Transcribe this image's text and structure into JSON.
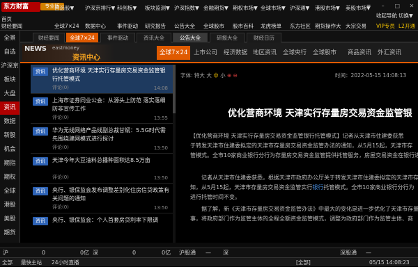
{
  "app": {
    "logo": "东方财富",
    "edition": "专业版"
  },
  "top_menu": {
    "row1": [
      "首页",
      "自选股▼",
      "沪深京排行▼",
      "科创板▼",
      "板块监测▼",
      "沪深指数▼",
      "金融期货▼",
      "期权市场▼",
      "全球市场▼",
      "沪深通▼",
      "港股市场▼",
      "美股市场▼",
      "收起导航",
      "切换▼"
    ],
    "row2": [
      "财经要闻",
      "全球7×24",
      "数据中心",
      "事件驱动",
      "研究报告",
      "公告大全",
      "全球股市",
      "股市百科",
      "龙虎榜单",
      "东方社区",
      "期货操作大",
      "大宗交易",
      "VIP专员",
      "L2开通"
    ]
  },
  "left_nav": [
    "全景",
    "自选",
    "沪深京",
    "板块",
    "大盘",
    "资讯",
    "数据",
    "新股",
    "机会",
    "期指",
    "期权",
    "全球",
    "港股",
    "美股",
    "期货"
  ],
  "left_nav_active": 5,
  "tabs1": [
    "财经要闻",
    "全球7×24",
    "事件驱动",
    "资讯大全",
    "公告大全",
    "研报大全",
    "财经日历"
  ],
  "tabs1_active": 1,
  "tabs1_selected": 4,
  "banner": {
    "news": "NEWS",
    "site": "eastmoney",
    "center": "资讯中心"
  },
  "categories": [
    "全球7×24",
    "上市公司",
    "经济数据",
    "地区资讯",
    "全球央行",
    "全球股市",
    "商品资讯",
    "外汇资讯"
  ],
  "categories_active": 0,
  "list": [
    {
      "badge": "资讯",
      "title": "优化营商环境 天津实行存量房交易资金监管银行托管模式",
      "comment": "评论(0)",
      "time": "14:08"
    },
    {
      "badge": "资讯",
      "title": "上海市证券同业公会：从源头上防范 落实落细防非宣传工作",
      "comment": "评论(0)",
      "time": "13:55"
    },
    {
      "badge": "资讯",
      "title": "华为无线网络产品线副总裁甘斌：5.5G时代需先围绕建网模式进行探讨",
      "comment": "评论(0)",
      "time": "13:50"
    },
    {
      "badge": "资讯",
      "title": "天津今年大豆油料总播种面积达8.5万亩",
      "comment": "评论(0)",
      "time": "13:50"
    },
    {
      "badge": "资讯",
      "title": "央行、银保监会发布调整差别化住房信贷政策有关问题的通知",
      "comment": "评论(0)",
      "time": "13:50"
    },
    {
      "badge": "资讯",
      "title": "央行、银保监会：个人首套房贷利率下限调",
      "comment": "",
      "time": ""
    }
  ],
  "article": {
    "font_label": "字体:",
    "font_sizes": [
      "特大",
      "大",
      "中",
      "小"
    ],
    "font_selected": 2,
    "time": "时间：2022-05-15 14:08:13",
    "title": "优化营商环境 天津实行存量房交易资金监管银",
    "paragraphs": [
      {
        "pre": "【优化营商环境 天津实行存量房交易资金监管银行托管模式】记者从天津市住建委获悉",
        "hl": "",
        "post": ""
      },
      {
        "pre": "于转发天津市住建委拟定的天津市存量房交易资金监管办法的通知，从5月15起，天津市存",
        "hl": "",
        "post": ""
      },
      {
        "pre": "管模式。全市10家商业银行分行为存量房交易资金监管提供托管服务，房屋交易资金在银行进行托管",
        "hl": "",
        "post": ""
      },
      {
        "pre": "　　记者从天津市住建委获悉，根据天津市政府办公厅关于转发天津市住建委拟定的天津市存",
        "hl": "",
        "post": ""
      },
      {
        "pre": "知，从5月15起，天津市存量房交易资金监管实行",
        "hl": "银行",
        "post": "托管模式。全市10家商业银行分行为"
      },
      {
        "pre": "进行托管时间不变。",
        "hl": "",
        "post": ""
      },
      {
        "pre": "　　据了解，新《天津市存量房交易资金监管办法》中最大的变化是进一步优化了天津市存量房",
        "hl": "",
        "post": ""
      },
      {
        "pre": "事，将政府部门作为监管主体的全程全额资金监管模式，调整为政府部门作为监管主体、商",
        "hl": "",
        "post": ""
      }
    ]
  },
  "quotes": {
    "sh": "沪",
    "sh_val": "0",
    "sh_unit": "0亿",
    "sz": "深",
    "sz_val": "0",
    "sz_unit": "0亿",
    "hsgt": "沪股通",
    "hsgt_val": "—",
    "shen": "深",
    "sgt": "深股通",
    "sgt_val": "—"
  },
  "status": {
    "items": [
      "全部",
      "最快主站",
      "24小时直播"
    ],
    "right": [
      "[全部]",
      "05/15 14:08:23"
    ]
  },
  "colors": {
    "accent": "#e05a00",
    "brand": "#b00000",
    "badge": "#2d62b5",
    "active_item": "#1e3a5f"
  }
}
